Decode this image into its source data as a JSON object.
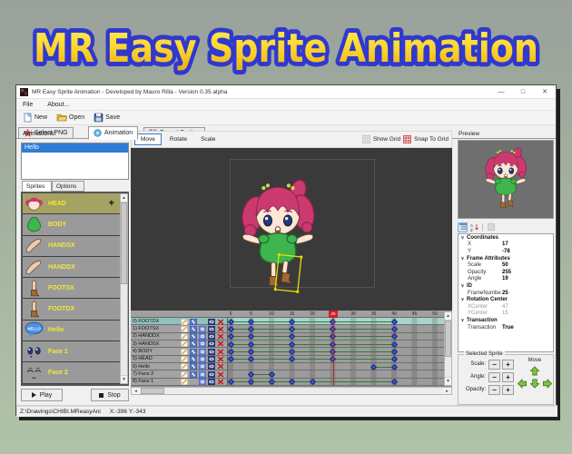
{
  "banner": {
    "title": "MR Easy Sprite Animation"
  },
  "window": {
    "title": "MR Easy Sprite Animation - Developed by Mauro Rilla - Version 0.35 alpha",
    "minimize": "—",
    "maximize": "□",
    "close": "✕"
  },
  "menubar": {
    "file": "File",
    "about": "About..."
  },
  "toolbar": {
    "new_label": "New",
    "open_label": "Open",
    "save_label": "Save"
  },
  "main_tabs": {
    "select_png": "Select PNG",
    "animation": "Animation",
    "export_sprites": "Export Sprites"
  },
  "animations_panel": {
    "label": "Animations:",
    "add": "+",
    "remove": "✕",
    "items": [
      {
        "name": "Hello",
        "selected": true
      }
    ]
  },
  "panel_tabs": {
    "sprites": "Sprites",
    "options": "Options"
  },
  "sprite_list": [
    {
      "name": "HEAD",
      "thumb": "head",
      "selected": true,
      "plus": "+"
    },
    {
      "name": "BODY",
      "thumb": "body"
    },
    {
      "name": "HANDSX",
      "thumb": "hand"
    },
    {
      "name": "HANDDX",
      "thumb": "hand"
    },
    {
      "name": "FOOTSX",
      "thumb": "foot"
    },
    {
      "name": "FOOTDX",
      "thumb": "foot"
    },
    {
      "name": "Hello",
      "thumb": "bubble",
      "thumb_text": "HELLO"
    },
    {
      "name": "Face 1",
      "thumb": "face1"
    },
    {
      "name": "Face 2",
      "thumb": "face2"
    }
  ],
  "transport": {
    "play": "Play",
    "stop": "Stop"
  },
  "canvas_toolbar": {
    "move": "Move",
    "rotate": "Rotate",
    "scale": "Scale",
    "show_grid": "Show Grid",
    "snap_to_grid": "Snap To Grid"
  },
  "timeline": {
    "ticks": [
      0,
      5,
      10,
      15,
      20,
      25,
      30,
      35,
      40,
      45,
      50
    ],
    "current_frame": 25,
    "rows": [
      {
        "label": "0) FOOTDX",
        "selected": true,
        "icons": [
          "pencil",
          "swap",
          null,
          "eye",
          "delete"
        ],
        "keyframes": [
          0,
          5,
          15,
          25,
          40
        ]
      },
      {
        "label": "1) FOOTSX",
        "icons": [
          "pencil",
          "swap",
          "tool",
          "eye",
          "delete"
        ],
        "keyframes": [
          0,
          5,
          15,
          25,
          40
        ]
      },
      {
        "label": "2) HANDDX",
        "icons": [
          "pencil",
          "swap",
          "tool",
          "eye",
          "delete"
        ],
        "keyframes": [
          0,
          5,
          15,
          25,
          40
        ]
      },
      {
        "label": "3) HANDSX",
        "icons": [
          "pencil",
          "swap",
          "tool",
          "eye",
          "delete"
        ],
        "keyframes": [
          0,
          5,
          15,
          25,
          40
        ]
      },
      {
        "label": "4) BODY",
        "icons": [
          "pencil",
          "swap",
          "tool",
          "eye",
          "delete"
        ],
        "keyframes": [
          0,
          5,
          15,
          25,
          40
        ]
      },
      {
        "label": "5) HEAD",
        "icons": [
          "pencil",
          "swap",
          "tool",
          "eye",
          "delete"
        ],
        "keyframes": [
          0,
          5,
          15,
          25,
          40
        ]
      },
      {
        "label": "6) Hello",
        "icons": [
          "pencil",
          "swap",
          "tool",
          "eye",
          "delete"
        ],
        "keyframes": [
          35,
          40
        ]
      },
      {
        "label": "7) Face 2",
        "icons": [
          "pencil",
          "swap",
          "tool",
          "eye",
          "delete"
        ],
        "keyframes": [
          5,
          10
        ]
      },
      {
        "label": "8) Face 1",
        "icons": [
          "pencil",
          null,
          "tool",
          "eye",
          "delete"
        ],
        "keyframes": [
          0,
          5,
          10,
          15,
          20,
          40
        ]
      }
    ]
  },
  "preview_panel": {
    "label": "Preview"
  },
  "properties": [
    {
      "group": "Coordinates",
      "rows": [
        {
          "key": "X",
          "value": "17"
        },
        {
          "key": "Y",
          "value": "-78"
        }
      ]
    },
    {
      "group": "Frame Attributes",
      "rows": [
        {
          "key": "Scale",
          "value": "50"
        },
        {
          "key": "Opacity",
          "value": "255"
        },
        {
          "key": "Angle",
          "value": "19"
        }
      ]
    },
    {
      "group": "ID",
      "rows": [
        {
          "key": "FrameNumbe",
          "value": "25"
        }
      ]
    },
    {
      "group": "Rotation Center",
      "rows": [
        {
          "key": "XCenter",
          "value": "47",
          "disabled": true
        },
        {
          "key": "YCenter",
          "value": "15",
          "disabled": true
        }
      ]
    },
    {
      "group": "Transaction",
      "rows": [
        {
          "key": "Transaction",
          "value": "True"
        }
      ]
    }
  ],
  "selected_sprite": {
    "label": "Selected Sprite",
    "scale": "Scale:",
    "angle": "Angle:",
    "opacity": "Opacity:",
    "minus": "−",
    "plus": "+",
    "move": "Move"
  },
  "status_bar": {
    "path": "Z:\\Drawings\\CHIBI.MReasyAni",
    "coords": "X:-396 Y:-343"
  },
  "colors": {
    "selection_blue": "#2f7cd6",
    "sprite_label_yellow": "#f0e93a",
    "timeline_selected_teal": "#8fc3bd",
    "keyframe_blue": "#3a5ae0",
    "playhead_red": "#cc2222",
    "arrow_green": "#7dc243",
    "banner_yellow": "#ffdf2b",
    "banner_outline_blue": "#3038cf"
  }
}
